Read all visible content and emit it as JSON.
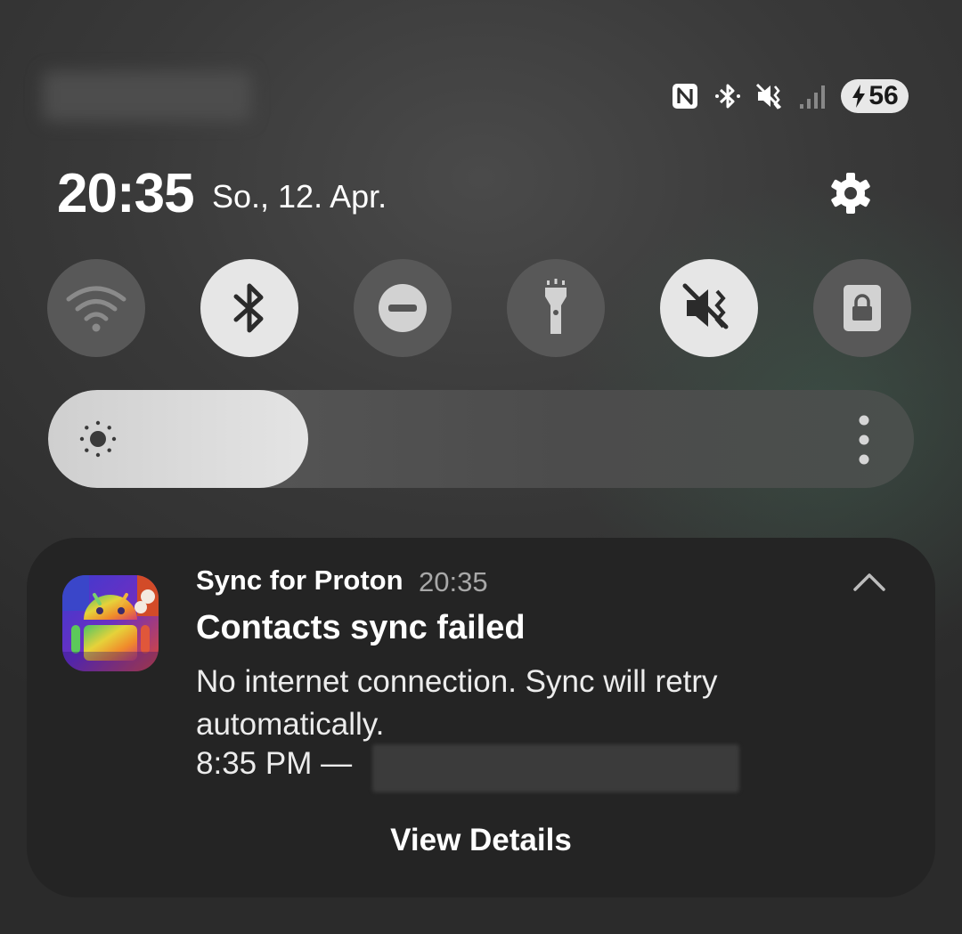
{
  "status_bar": {
    "icons": [
      "nfc-icon",
      "bluetooth-icon",
      "vibrate-mute-icon",
      "signal-icon"
    ],
    "battery_level": "56"
  },
  "header": {
    "time": "20:35",
    "date": "So., 12. Apr."
  },
  "quick_tiles": [
    {
      "name": "wifi",
      "icon": "wifi-icon",
      "active": false
    },
    {
      "name": "bluetooth",
      "icon": "bluetooth-icon",
      "active": true
    },
    {
      "name": "do-not-disturb",
      "icon": "minus-circle-icon",
      "active": false
    },
    {
      "name": "flashlight",
      "icon": "flashlight-icon",
      "active": false
    },
    {
      "name": "mute",
      "icon": "mute-icon",
      "active": true
    },
    {
      "name": "screen-lock",
      "icon": "lock-icon",
      "active": false
    }
  ],
  "brightness": {
    "level": 0.3
  },
  "notification": {
    "app_name": "Sync for Proton",
    "app_time": "20:35",
    "title": "Contacts sync failed",
    "body": "No internet connection. Sync will retry automatically.",
    "timestamp": "8:35 PM —",
    "action_label": "View Details"
  },
  "colors": {
    "tile_on": "#e6e6e6",
    "tile_off": "#585858",
    "card_bg": "#242424"
  }
}
